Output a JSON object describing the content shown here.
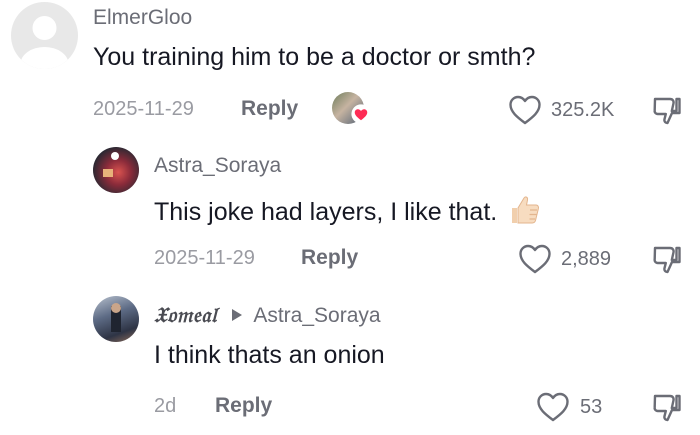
{
  "comments": [
    {
      "username": "ElmerGloo",
      "text": "You training him to be a doctor or smth?",
      "date": "2025-11-29",
      "reply_label": "Reply",
      "likes": "325.2K",
      "liked_by_creator": true
    },
    {
      "username": "Astra_Soraya",
      "text": "This joke had layers, I like that.",
      "emoji": "thumbs-up",
      "date": "2025-11-29",
      "reply_label": "Reply",
      "likes": "2,889"
    },
    {
      "username": "𝔛𝔬𝔪𝔢𝔞𝔩",
      "reply_to": "Astra_Soraya",
      "text": "I think thats an onion",
      "date": "2d",
      "reply_label": "Reply",
      "likes": "53"
    }
  ],
  "colors": {
    "text_primary": "#161823",
    "text_secondary": "#6b6d76",
    "text_tertiary": "#9a9ba2",
    "creator_heart": "#fe2c55"
  },
  "icons": [
    "default-avatar-icon",
    "heart-outline-icon",
    "dislike-icon",
    "play-triangle-icon",
    "thumbs-up-emoji",
    "creator-liked-heart-icon"
  ]
}
